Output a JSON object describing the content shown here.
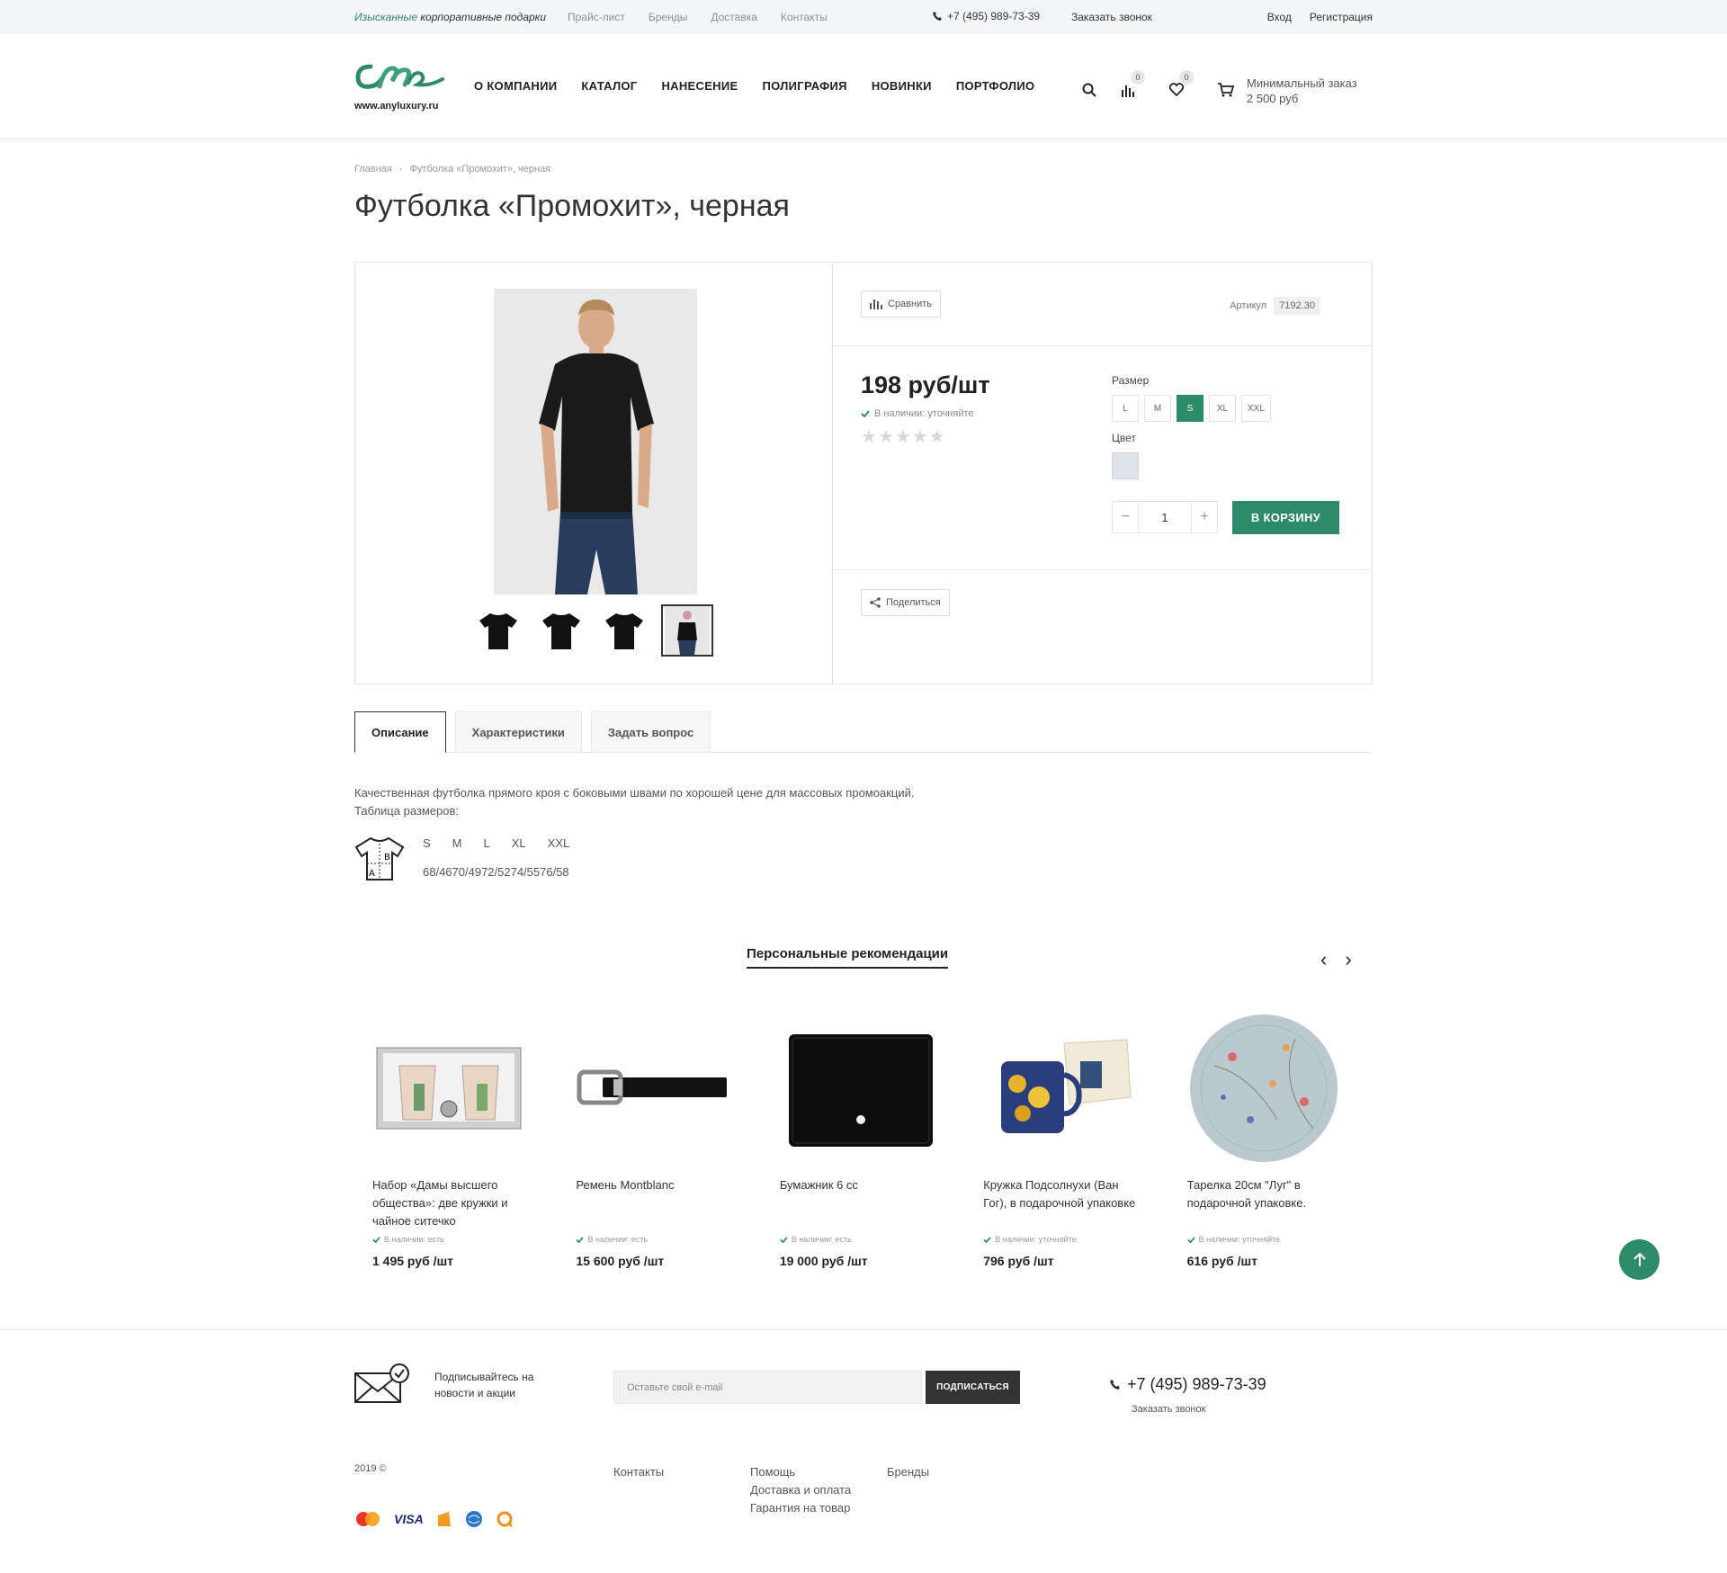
{
  "topbar": {
    "tagline_accent": "Изысканные",
    "tagline_rest": "корпоративные подарки",
    "links": [
      "Прайс-лист",
      "Бренды",
      "Доставка",
      "Контакты"
    ],
    "phone": "+7 (495) 989-73-39",
    "callback": "Заказать звонок",
    "login": "Вход",
    "register": "Регистрация"
  },
  "header": {
    "logo_url": "www.anyluxury.ru",
    "nav": [
      "О КОМПАНИИ",
      "КАТАЛОГ",
      "НАНЕСЕНИЕ",
      "ПОЛИГРАФИЯ",
      "НОВИНКИ",
      "ПОРТФОЛИО"
    ],
    "compare_count": "0",
    "wishlist_count": "0",
    "min_order_label": "Минимальный заказ",
    "min_order_value": "2 500 руб"
  },
  "breadcrumb": [
    "Главная",
    "-",
    "Футболка «Промохит», черная"
  ],
  "product": {
    "title": "Футболка «Промохит», черная",
    "compare_label": "Сравнить",
    "article_label": "Артикул",
    "article_value": "7192.30",
    "price": "198 руб/шт",
    "stock": "В наличии: уточняйте",
    "rating_stars": 5,
    "size_label": "Размер",
    "sizes": [
      "L",
      "M",
      "S",
      "XL",
      "XXL"
    ],
    "selected_size": "S",
    "color_label": "Цвет",
    "swatch_color": "#dfe3ea",
    "quantity": "1",
    "cart_button": "В КОРЗИНУ",
    "share_label": "Поделиться"
  },
  "tabs": [
    "Описание",
    "Характеристики",
    "Задать вопрос"
  ],
  "description": {
    "text": "Качественная футболка прямого кроя с боковыми швами по хорошей цене для массовых промоакций.",
    "size_table_label": "Таблица размеров:",
    "size_heads": [
      "S",
      "M",
      "L",
      "XL",
      "XXL"
    ],
    "size_values": "68/4670/4972/5274/5576/58"
  },
  "recommendations": {
    "title": "Персональные рекомендации",
    "items": [
      {
        "name": "Набор «Дамы высшего общества»: две кружки и чайное ситечко",
        "stock": "В наличии: есть",
        "price": "1 495 руб /шт"
      },
      {
        "name": "Ремень Montblanc",
        "stock": "В наличии: есть",
        "price": "15 600 руб /шт"
      },
      {
        "name": "Бумажник 6 cc",
        "stock": "В наличии: есть",
        "price": "19 000 руб /шт"
      },
      {
        "name": "Кружка Подсолнухи (Ван Гог), в подарочной упаковке",
        "stock": "В наличии: уточняйте",
        "price": "796 руб /шт"
      },
      {
        "name": "Тарелка 20см \"Луг\" в подарочной упаковке.",
        "stock": "В наличии: уточняйте",
        "price": "616 руб /шт"
      }
    ]
  },
  "footer": {
    "subscribe_text": "Подписывайтесь на новости и акции",
    "email_placeholder": "Оставьте свой e-mail",
    "subscribe_button": "ПОДПИСАТЬСЯ",
    "phone": "+7 (495) 989-73-39",
    "callback": "Заказать звонок",
    "copyright": "2019 ©",
    "col1": [
      "Контакты"
    ],
    "col2": [
      "Помощь",
      "Доставка и оплата",
      "Гарантия на товар"
    ],
    "col3": [
      "Бренды"
    ],
    "payment_text": "VISA"
  },
  "colors": {
    "accent": "#2e8b6a",
    "dark": "#333333"
  }
}
